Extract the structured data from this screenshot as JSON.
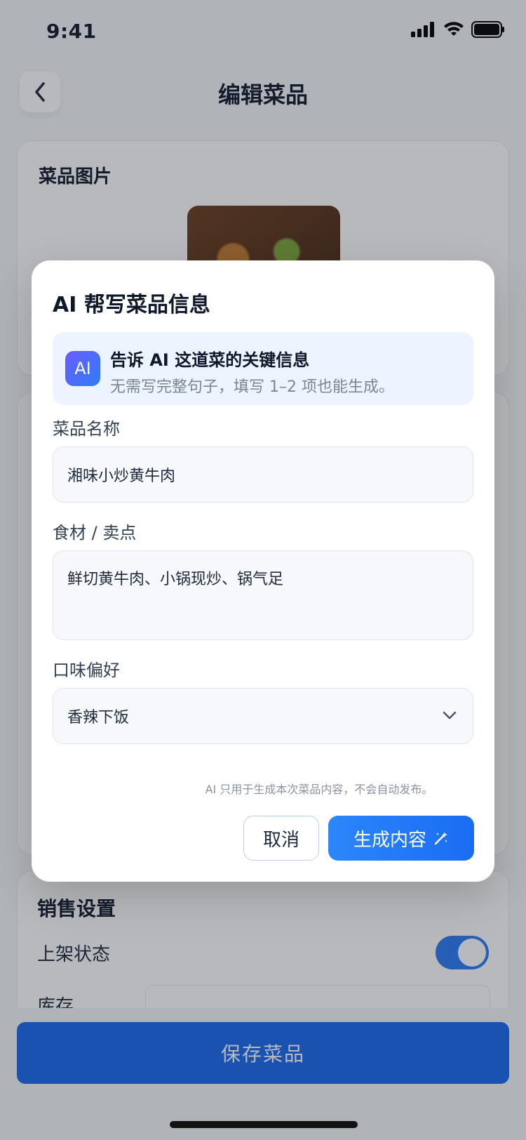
{
  "status_bar": {
    "time": "9:41"
  },
  "header": {
    "title": "编辑菜品"
  },
  "image_card": {
    "label": "菜品图片"
  },
  "sales": {
    "title": "销售设置",
    "listing_label": "上架状态",
    "stock_label": "库存"
  },
  "footer": {
    "save_label": "保存菜品"
  },
  "modal": {
    "title": "AI 帮写菜品信息",
    "tip": {
      "badge": "AI",
      "title": "告诉 AI 这道菜的关键信息",
      "subtitle": "无需写完整句子，填写 1–2 项也能生成。"
    },
    "fields": {
      "name_label": "菜品名称",
      "name_value": "湘味小炒黄牛肉",
      "ingredients_label": "食材 / 卖点",
      "ingredients_value": "鲜切黄牛肉、小锅现炒、锅气足",
      "taste_label": "口味偏好",
      "taste_value": "香辣下饭"
    },
    "disclaimer": "AI 只用于生成本次菜品内容，不会自动发布。",
    "cancel_label": "取消",
    "generate_label": "生成内容"
  },
  "colors": {
    "accent": "#1868f0",
    "toggle_on": "#2a7af5"
  }
}
